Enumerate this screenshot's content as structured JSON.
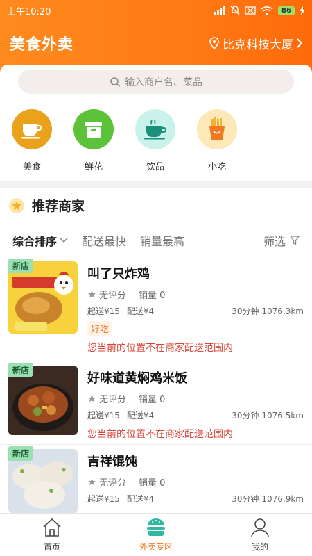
{
  "status_bar": {
    "time": "上午10:20",
    "battery": "86"
  },
  "header": {
    "app_title": "美食外卖",
    "location": "比克科技大厦"
  },
  "search": {
    "placeholder": "输入商户名、菜品"
  },
  "categories": [
    {
      "label": "美食",
      "icon": "coffee-cup-icon",
      "color": "#e9a21a"
    },
    {
      "label": "鲜花",
      "icon": "gift-box-icon",
      "color": "#5bc23a"
    },
    {
      "label": "饮品",
      "icon": "teacup-icon",
      "color": "#c8f2ea"
    },
    {
      "label": "小吃",
      "icon": "fries-icon",
      "color": "#fde8b8"
    }
  ],
  "section": {
    "title": "推荐商家"
  },
  "sort": {
    "options": [
      "综合排序",
      "配送最快",
      "销量最高"
    ],
    "filter": "筛选"
  },
  "merchants": [
    {
      "badge": "新店",
      "name": "叫了只炸鸡",
      "rating": "无评分",
      "sales": "销量 0",
      "min_order": "起送¥15",
      "delivery_fee": "配送¥4",
      "eta": "30分钟 1076.3km",
      "tag": "好吃",
      "warning": "您当前的位置不在商家配送范围内"
    },
    {
      "badge": "新店",
      "name": "好味道黄焖鸡米饭",
      "rating": "无评分",
      "sales": "销量 0",
      "min_order": "起送¥15",
      "delivery_fee": "配送¥4",
      "eta": "30分钟 1076.5km",
      "warning": "您当前的位置不在商家配送范围内"
    },
    {
      "badge": "新店",
      "name": "吉祥馄饨",
      "rating": "无评分",
      "sales": "销量 0",
      "min_order": "起送¥15",
      "delivery_fee": "配送¥4",
      "eta": "30分钟 1076.9km"
    }
  ],
  "bottom_nav": [
    {
      "label": "首页",
      "icon": "home-icon"
    },
    {
      "label": "外卖专区",
      "icon": "burger-icon",
      "active": true
    },
    {
      "label": "我的",
      "icon": "user-icon"
    }
  ],
  "colors": {
    "accent": "#ff7a14",
    "warning": "#d6483a",
    "active_tab": "#f07a20"
  }
}
